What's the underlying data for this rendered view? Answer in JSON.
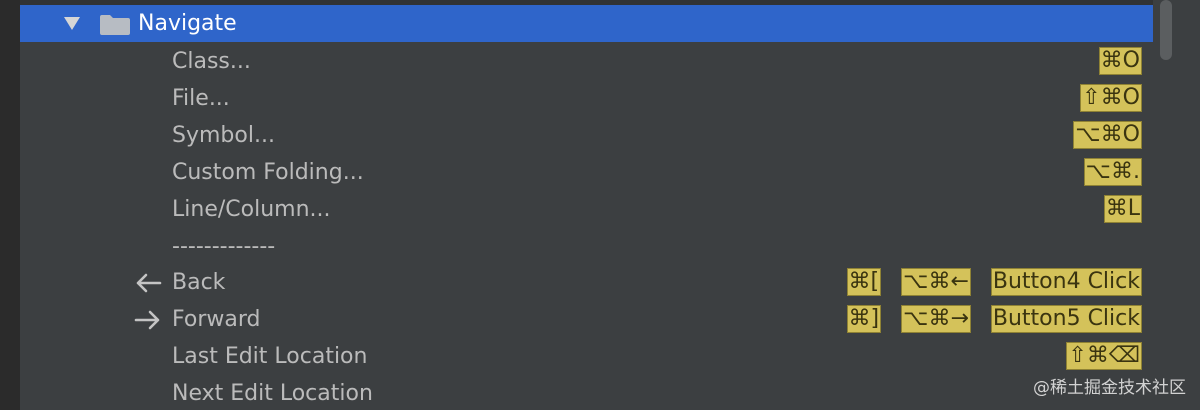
{
  "colors": {
    "background": "#3c3f41",
    "selection": "#2f65ca",
    "shortcut_highlight": "#d4c25a",
    "text": "#bbbbbb"
  },
  "tree": {
    "group": {
      "label": "Navigate",
      "expanded": true,
      "icon": "folder-icon"
    },
    "items": [
      {
        "label": "Class...",
        "shortcuts": [
          "⌘O"
        ]
      },
      {
        "label": "File...",
        "shortcuts": [
          "⇧⌘O"
        ]
      },
      {
        "label": "Symbol...",
        "shortcuts": [
          "⌥⌘O"
        ]
      },
      {
        "label": "Custom Folding...",
        "shortcuts": [
          "⌥⌘."
        ]
      },
      {
        "label": "Line/Column...",
        "shortcuts": [
          "⌘L"
        ]
      },
      {
        "label": "-------------",
        "shortcuts": []
      },
      {
        "label": "Back",
        "icon": "arrow-left-icon",
        "shortcuts": [
          "⌘[",
          "⌥⌘←",
          "Button4 Click"
        ]
      },
      {
        "label": "Forward",
        "icon": "arrow-right-icon",
        "shortcuts": [
          "⌘]",
          "⌥⌘→",
          "Button5 Click"
        ]
      },
      {
        "label": "Last Edit Location",
        "shortcuts": [
          "⇧⌘⌫"
        ]
      },
      {
        "label": "Next Edit Location",
        "shortcuts": []
      }
    ]
  },
  "watermark": "@稀土掘金技术社区"
}
